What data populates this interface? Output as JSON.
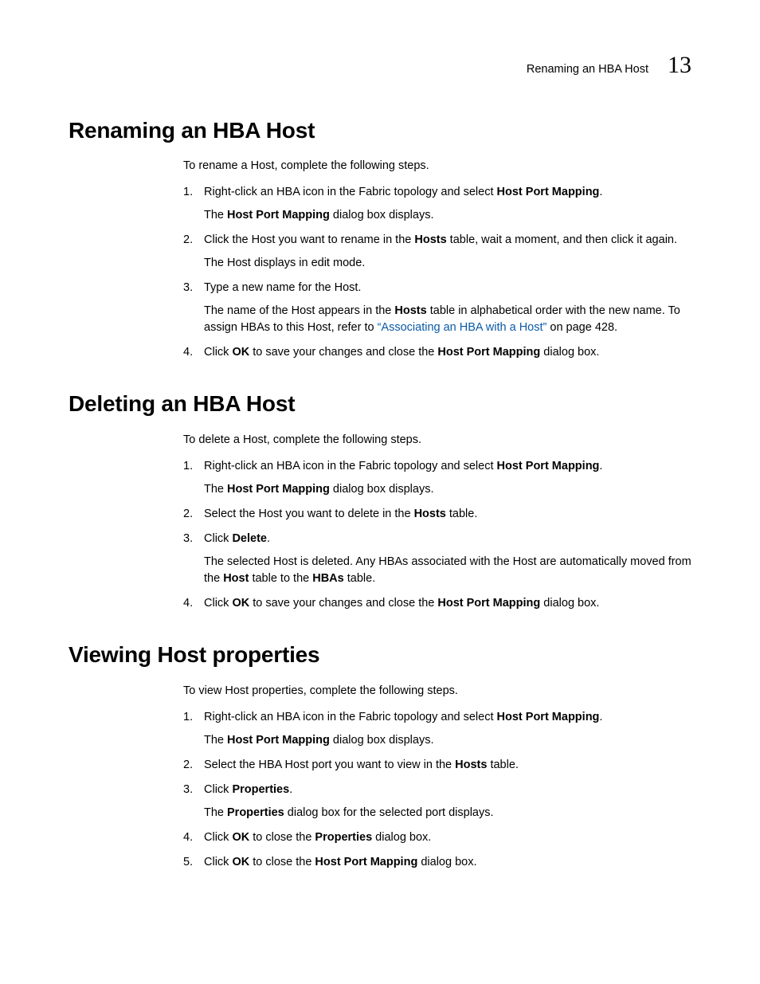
{
  "header": {
    "running_title": "Renaming an HBA Host",
    "chapter_number": "13"
  },
  "sections": [
    {
      "title": "Renaming an HBA Host",
      "intro": "To rename a Host, complete the following steps.",
      "steps": [
        {
          "num": "1.",
          "segments": [
            {
              "t": "Right-click an HBA icon in the Fabric topology and select "
            },
            {
              "t": "Host Port Mapping",
              "b": true
            },
            {
              "t": "."
            }
          ],
          "body": [
            [
              {
                "t": "The "
              },
              {
                "t": "Host Port Mapping",
                "b": true
              },
              {
                "t": " dialog box displays."
              }
            ]
          ]
        },
        {
          "num": "2.",
          "segments": [
            {
              "t": "Click the Host you want to rename in the "
            },
            {
              "t": "Hosts",
              "b": true
            },
            {
              "t": " table, wait a moment, and then click it again."
            }
          ],
          "body": [
            [
              {
                "t": "The Host displays in edit mode."
              }
            ]
          ]
        },
        {
          "num": "3.",
          "segments": [
            {
              "t": "Type a new name for the Host."
            }
          ],
          "body": [
            [
              {
                "t": "The name of the Host appears in the "
              },
              {
                "t": "Hosts",
                "b": true
              },
              {
                "t": " table in alphabetical order with the new name. To assign HBAs to this Host, refer to "
              },
              {
                "t": "“Associating an HBA with a Host”",
                "link": true
              },
              {
                "t": " on page 428."
              }
            ]
          ]
        },
        {
          "num": "4.",
          "segments": [
            {
              "t": "Click "
            },
            {
              "t": "OK",
              "b": true
            },
            {
              "t": " to save your changes and close the "
            },
            {
              "t": "Host Port Mapping",
              "b": true
            },
            {
              "t": " dialog box."
            }
          ],
          "body": []
        }
      ]
    },
    {
      "title": "Deleting an HBA Host",
      "intro": "To delete a Host, complete the following steps.",
      "steps": [
        {
          "num": "1.",
          "segments": [
            {
              "t": "Right-click an HBA icon in the Fabric topology and select "
            },
            {
              "t": "Host Port Mapping",
              "b": true
            },
            {
              "t": "."
            }
          ],
          "body": [
            [
              {
                "t": "The "
              },
              {
                "t": "Host Port Mapping",
                "b": true
              },
              {
                "t": " dialog box displays."
              }
            ]
          ]
        },
        {
          "num": "2.",
          "segments": [
            {
              "t": "Select the Host you want to delete in the "
            },
            {
              "t": "Hosts",
              "b": true
            },
            {
              "t": " table."
            }
          ],
          "body": []
        },
        {
          "num": "3.",
          "segments": [
            {
              "t": "Click "
            },
            {
              "t": "Delete",
              "b": true
            },
            {
              "t": "."
            }
          ],
          "body": [
            [
              {
                "t": "The selected Host is deleted. Any HBAs associated with the Host are automatically moved from the "
              },
              {
                "t": "Host",
                "b": true
              },
              {
                "t": " table to the "
              },
              {
                "t": "HBAs",
                "b": true
              },
              {
                "t": " table."
              }
            ]
          ]
        },
        {
          "num": "4.",
          "segments": [
            {
              "t": "Click "
            },
            {
              "t": "OK",
              "b": true
            },
            {
              "t": " to save your changes and close the "
            },
            {
              "t": "Host Port Mapping",
              "b": true
            },
            {
              "t": " dialog box."
            }
          ],
          "body": []
        }
      ]
    },
    {
      "title": "Viewing Host properties",
      "intro": "To view Host properties, complete the following steps.",
      "steps": [
        {
          "num": "1.",
          "segments": [
            {
              "t": "Right-click an HBA icon in the Fabric topology and select "
            },
            {
              "t": "Host Port Mapping",
              "b": true
            },
            {
              "t": "."
            }
          ],
          "body": [
            [
              {
                "t": "The "
              },
              {
                "t": "Host Port Mapping",
                "b": true
              },
              {
                "t": " dialog box displays."
              }
            ]
          ]
        },
        {
          "num": "2.",
          "segments": [
            {
              "t": "Select the HBA Host port you want to view in the "
            },
            {
              "t": "Hosts",
              "b": true
            },
            {
              "t": " table."
            }
          ],
          "body": []
        },
        {
          "num": "3.",
          "segments": [
            {
              "t": "Click "
            },
            {
              "t": "Properties",
              "b": true
            },
            {
              "t": "."
            }
          ],
          "body": [
            [
              {
                "t": "The "
              },
              {
                "t": "Properties",
                "b": true
              },
              {
                "t": " dialog box for the selected port displays."
              }
            ]
          ]
        },
        {
          "num": "4.",
          "segments": [
            {
              "t": "Click "
            },
            {
              "t": "OK",
              "b": true
            },
            {
              "t": " to close the "
            },
            {
              "t": "Properties",
              "b": true
            },
            {
              "t": " dialog box."
            }
          ],
          "body": []
        },
        {
          "num": "5.",
          "segments": [
            {
              "t": "Click "
            },
            {
              "t": "OK",
              "b": true
            },
            {
              "t": " to close the "
            },
            {
              "t": "Host Port Mapping",
              "b": true
            },
            {
              "t": " dialog box."
            }
          ],
          "body": []
        }
      ]
    }
  ]
}
